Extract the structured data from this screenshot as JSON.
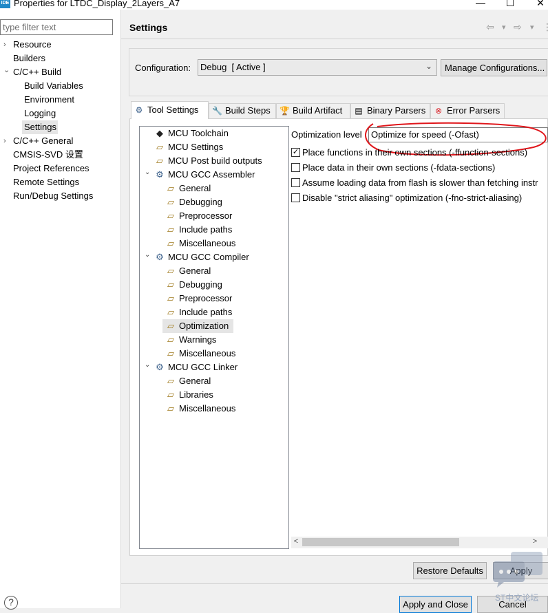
{
  "window": {
    "title": "Properties for LTDC_Display_2Layers_A7",
    "icon_label": "IDE",
    "minimize": "—",
    "maximize": "☐",
    "close": "✕"
  },
  "filter": {
    "placeholder": "type filter text"
  },
  "nav": {
    "items": [
      {
        "label": "Resource",
        "arrow": "›",
        "level": 0
      },
      {
        "label": "Builders",
        "arrow": "",
        "level": 0
      },
      {
        "label": "C/C++ Build",
        "arrow": "⌄",
        "level": 0
      },
      {
        "label": "Build Variables",
        "arrow": "",
        "level": 1
      },
      {
        "label": "Environment",
        "arrow": "",
        "level": 1
      },
      {
        "label": "Logging",
        "arrow": "",
        "level": 1
      },
      {
        "label": "Settings",
        "arrow": "",
        "level": 1,
        "selected": true
      },
      {
        "label": "C/C++ General",
        "arrow": "›",
        "level": 0
      },
      {
        "label": "CMSIS-SVD 设置",
        "arrow": "",
        "level": 0
      },
      {
        "label": "Project References",
        "arrow": "",
        "level": 0
      },
      {
        "label": "Remote Settings",
        "arrow": "",
        "level": 0
      },
      {
        "label": "Run/Debug Settings",
        "arrow": "",
        "level": 0
      }
    ]
  },
  "header": {
    "title": "Settings",
    "back_icon": "⇦",
    "forward_icon": "⇨",
    "dropdown_icon": "▾",
    "more_icon": "⋮"
  },
  "config": {
    "label": "Configuration:",
    "value": "Debug  [ Active ]",
    "chevron": "⌄",
    "manage_label": "Manage Configurations..."
  },
  "tabs": [
    {
      "label": "Tool Settings",
      "icon": "⚙",
      "active": true
    },
    {
      "label": "Build Steps",
      "icon": "🔧"
    },
    {
      "label": "Build Artifact",
      "icon": "🏆"
    },
    {
      "label": "Binary Parsers",
      "icon": "▤"
    },
    {
      "label": "Error Parsers",
      "icon": "⊗"
    }
  ],
  "tree": {
    "items": [
      {
        "label": "MCU Toolchain",
        "icon": "chip",
        "level": 0,
        "twist": ""
      },
      {
        "label": "MCU Settings",
        "icon": "folder",
        "level": 0,
        "twist": ""
      },
      {
        "label": "MCU Post build outputs",
        "icon": "folder",
        "level": 0,
        "twist": ""
      },
      {
        "label": "MCU GCC Assembler",
        "icon": "gear",
        "level": 0,
        "twist": "⌄"
      },
      {
        "label": "General",
        "icon": "folder",
        "level": 1,
        "twist": ""
      },
      {
        "label": "Debugging",
        "icon": "folder",
        "level": 1,
        "twist": ""
      },
      {
        "label": "Preprocessor",
        "icon": "folder",
        "level": 1,
        "twist": ""
      },
      {
        "label": "Include paths",
        "icon": "folder",
        "level": 1,
        "twist": ""
      },
      {
        "label": "Miscellaneous",
        "icon": "folder",
        "level": 1,
        "twist": ""
      },
      {
        "label": "MCU GCC Compiler",
        "icon": "gear",
        "level": 0,
        "twist": "⌄"
      },
      {
        "label": "General",
        "icon": "folder",
        "level": 1,
        "twist": ""
      },
      {
        "label": "Debugging",
        "icon": "folder",
        "level": 1,
        "twist": ""
      },
      {
        "label": "Preprocessor",
        "icon": "folder",
        "level": 1,
        "twist": ""
      },
      {
        "label": "Include paths",
        "icon": "folder",
        "level": 1,
        "twist": ""
      },
      {
        "label": "Optimization",
        "icon": "folder",
        "level": 1,
        "twist": "",
        "selected": true
      },
      {
        "label": "Warnings",
        "icon": "folder",
        "level": 1,
        "twist": ""
      },
      {
        "label": "Miscellaneous",
        "icon": "folder",
        "level": 1,
        "twist": ""
      },
      {
        "label": "MCU GCC Linker",
        "icon": "gear",
        "level": 0,
        "twist": "⌄"
      },
      {
        "label": "General",
        "icon": "folder",
        "level": 1,
        "twist": ""
      },
      {
        "label": "Libraries",
        "icon": "folder",
        "level": 1,
        "twist": ""
      },
      {
        "label": "Miscellaneous",
        "icon": "folder",
        "level": 1,
        "twist": ""
      }
    ]
  },
  "optimization": {
    "level_label": "Optimization level",
    "level_value": "Optimize for speed (-Ofast)",
    "checkboxes": [
      {
        "label": "Place functions in their own sections (-ffunction-sections)",
        "checked": true
      },
      {
        "label": "Place data in their own sections (-fdata-sections)",
        "checked": false
      },
      {
        "label": "Assume loading data from flash is slower than fetching instr",
        "checked": false
      },
      {
        "label": "Disable \"strict aliasing\" optimization (-fno-strict-aliasing)",
        "checked": false
      }
    ]
  },
  "scrollbar": {
    "left": "<",
    "right": ">"
  },
  "buttons": {
    "restore_defaults": "Restore Defaults",
    "apply": "Apply",
    "apply_and_close": "Apply and Close",
    "cancel": "Cancel",
    "help": "?"
  },
  "watermark": {
    "text": "ST中文论坛"
  },
  "colors": {
    "annotation_red": "#e0161b",
    "selection": "#e5e5e5",
    "panel": "#f0f0f0"
  }
}
